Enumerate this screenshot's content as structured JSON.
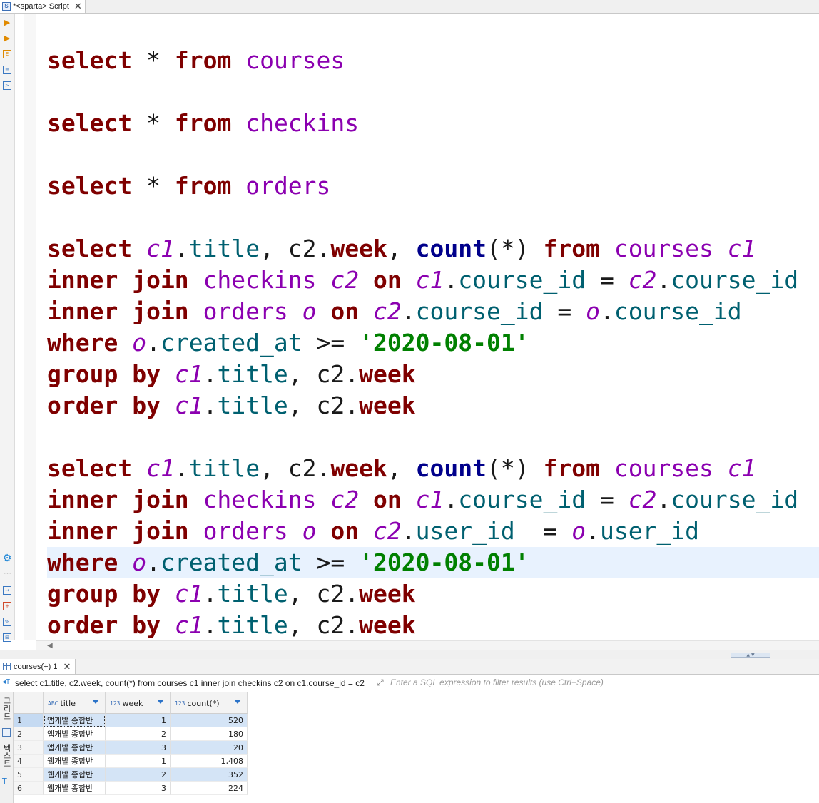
{
  "window": {
    "tab_title": "*<sparta> Script",
    "tab_close": "✕"
  },
  "toolbar": {
    "items": [
      "run-statement-icon",
      "run-script-icon",
      "execution-plan-icon",
      "load-sql-icon",
      "open-console-icon",
      "settings-icon",
      "export-icon",
      "new-script-icon",
      "format-icon",
      "outline-icon"
    ]
  },
  "editor": {
    "current_line": 16
  },
  "results": {
    "tab_label": "courses(+) 1",
    "tab_close": "✕",
    "query_text": "select c1.title, c2.week, count(*) from courses c1 inner join checkins c2 on c1.course_id = c2",
    "filter_placeholder": "Enter a SQL expression to filter results (use Ctrl+Space)",
    "side_tabs": [
      "그리드",
      "텍스트"
    ],
    "columns": [
      {
        "label": "title",
        "type": "ABC"
      },
      {
        "label": "week",
        "type": "123"
      },
      {
        "label": "count(*)",
        "type": "123"
      }
    ],
    "rows": [
      {
        "n": "1",
        "title": "앱개발 종합반",
        "week": "1",
        "count": "520"
      },
      {
        "n": "2",
        "title": "앱개발 종합반",
        "week": "2",
        "count": "180"
      },
      {
        "n": "3",
        "title": "앱개발 종합반",
        "week": "3",
        "count": "20"
      },
      {
        "n": "4",
        "title": "웹개발 종합반",
        "week": "1",
        "count": "1,408"
      },
      {
        "n": "5",
        "title": "웹개발 종합반",
        "week": "2",
        "count": "352"
      },
      {
        "n": "6",
        "title": "웹개발 종합반",
        "week": "3",
        "count": "224"
      }
    ]
  },
  "colors": {
    "keyword": "#7f0000",
    "function": "#00008b",
    "table": "#8b00b0",
    "column": "#006070",
    "string": "#008000",
    "current_line": "#e8f2fe"
  }
}
